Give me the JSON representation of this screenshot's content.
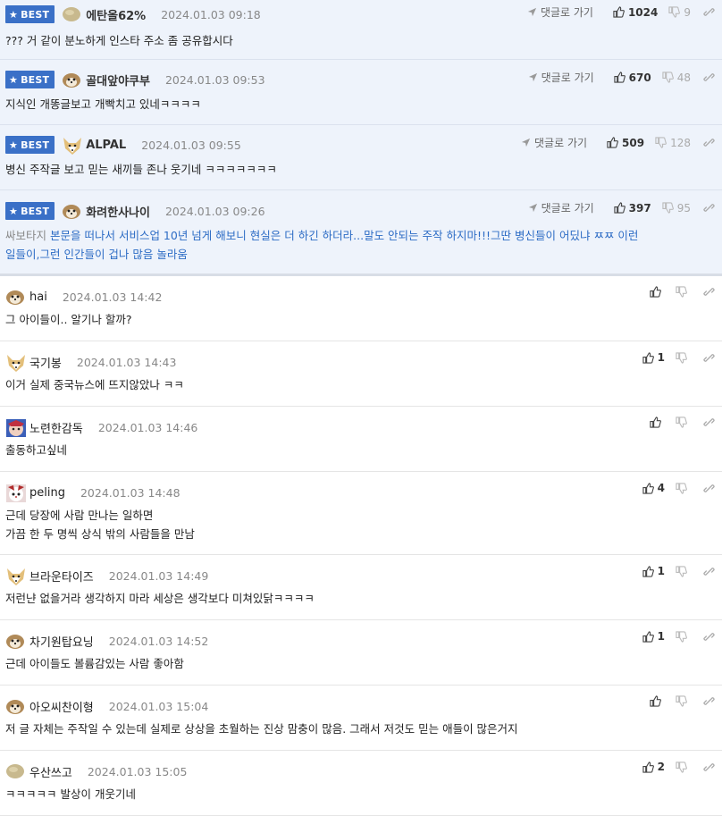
{
  "reply_label": "댓글로 가기",
  "best_label": "BEST",
  "best_comments": [
    {
      "nick": "에탄올62%",
      "date": "2024.01.03 09:18",
      "avatar": "round-avatar",
      "up": "1024",
      "down": "9",
      "text": "??? 거 같이 분노하게 인스타 주소 좀 공유합시다"
    },
    {
      "nick": "골대앞야쿠부",
      "date": "2024.01.03 09:53",
      "avatar": "dog-avatar",
      "up": "670",
      "down": "48",
      "text": "지식인 개똥글보고 개빡치고 있네ㅋㅋㅋㅋ"
    },
    {
      "nick": "ALPAL",
      "date": "2024.01.03 09:55",
      "avatar": "fox-avatar",
      "up": "509",
      "down": "128",
      "text": "병신 주작글 보고 믿는 새끼들 존나 웃기네 ㅋㅋㅋㅋㅋㅋㅋ"
    },
    {
      "nick": "화려한사나이",
      "date": "2024.01.03 09:26",
      "avatar": "dog-avatar",
      "up": "397",
      "down": "95",
      "text_prefix": "싸보타지",
      "text_line1": "본문을 떠나서 서비스업 10년 넘게 해보니 현실은 더 하긴 하더라...말도 안되는 주작 하지마!!!그딴 병신들이 어딨냐 ㅉㅉ 이런",
      "text_line2": "일들이,그런 인간들이 겁나 많음 놀라움"
    }
  ],
  "comments": [
    {
      "nick": "hai",
      "date": "2024.01.03 14:42",
      "avatar": "dog-avatar",
      "up": "",
      "text": [
        "그 아이들이.. 알기나 할까?"
      ]
    },
    {
      "nick": "국기봉",
      "date": "2024.01.03 14:43",
      "avatar": "fox-avatar",
      "up": "1",
      "text": [
        "이거 실제 중국뉴스에 뜨지않았나 ㅋㅋ"
      ]
    },
    {
      "nick": "노련한감독",
      "date": "2024.01.03 14:46",
      "avatar": "blue-avatar",
      "up": "",
      "text": [
        "출동하고싶네"
      ]
    },
    {
      "nick": "peling",
      "date": "2024.01.03 14:48",
      "avatar": "red-avatar",
      "up": "4",
      "text": [
        "근데 당장에 사람 만나는 일하면",
        "가끔 한 두 명씩 상식 밖의 사람들을 만남"
      ]
    },
    {
      "nick": "브라운타이즈",
      "date": "2024.01.03 14:49",
      "avatar": "fox-avatar",
      "up": "1",
      "text": [
        "저런냔 없을거라 생각하지 마라 세상은 생각보다 미쳐있닭ㅋㅋㅋㅋ"
      ]
    },
    {
      "nick": "차기원탑요닝",
      "date": "2024.01.03 14:52",
      "avatar": "dog-avatar",
      "up": "1",
      "text": [
        "근데 아이들도 볼륨감있는 사람 좋아함"
      ]
    },
    {
      "nick": "아오씨찬이형",
      "date": "2024.01.03 15:04",
      "avatar": "dog-avatar",
      "up": "",
      "text": [
        "저 글 자체는 주작일 수 있는데 실제로 상상을 초월하는 진상 맘충이 많음. 그래서 저것도 믿는 애들이 많은거지"
      ]
    },
    {
      "nick": "우산쓰고",
      "date": "2024.01.03 15:05",
      "avatar": "round-avatar",
      "up": "2",
      "text": [
        "ㅋㅋㅋㅋㅋ 발상이 개웃기네"
      ]
    }
  ]
}
